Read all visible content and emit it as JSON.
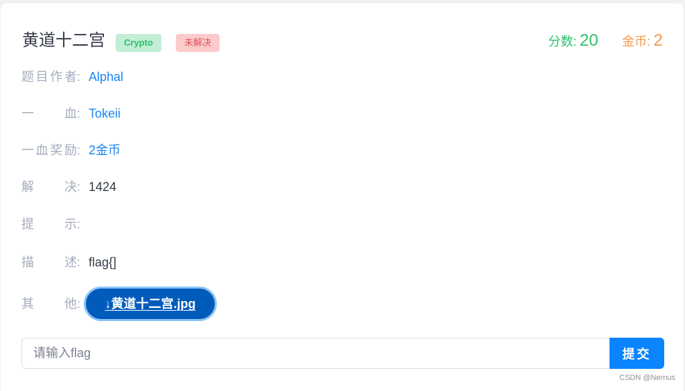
{
  "challenge": {
    "title": "黄道十二宫",
    "category_tag": "Crypto",
    "status_tag": "未解决",
    "score_label": "分数:",
    "score_value": "20",
    "coins_label": "金币:",
    "coins_value": "2"
  },
  "info_rows": [
    {
      "label": "题目作者",
      "value": "Alphal"
    },
    {
      "label": "一血",
      "value": "Tokeii"
    },
    {
      "label": "一血奖励",
      "value": "2金币"
    },
    {
      "label": "解决",
      "value": "1424"
    },
    {
      "label": "提示",
      "value": ""
    },
    {
      "label": "描述",
      "value": "flag{]"
    },
    {
      "label": "其他",
      "value": ""
    }
  ],
  "colon": ":",
  "attachment": {
    "icon": "download-arrow-icon",
    "arrow_glyph": "↓",
    "filename": "黄道十二宫.jpg"
  },
  "submit_form": {
    "placeholder": "请输入flag",
    "value": "",
    "submit_label": "提交"
  },
  "watermark": "CSDN @Nernus",
  "colors": {
    "score_green": "#2bbf6a",
    "coins_orange": "#f2994a",
    "link_blue": "#1a86f0",
    "download_button": "#005bbb",
    "submit_button": "#0a84ff"
  }
}
